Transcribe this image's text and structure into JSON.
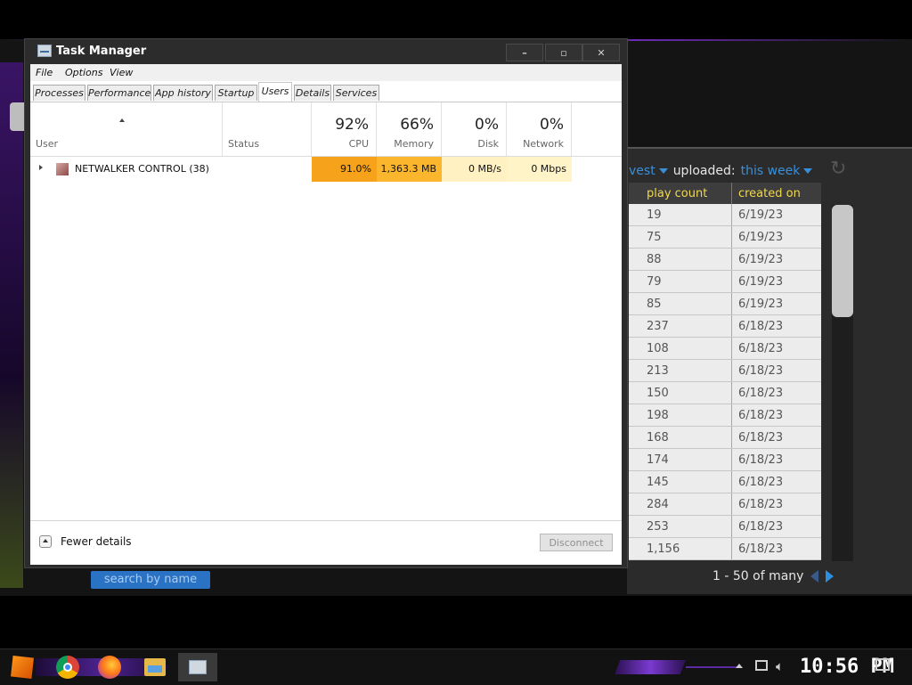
{
  "background_app": {
    "filters": {
      "sort_partial": "vest",
      "uploaded_label": "uploaded:",
      "uploaded_value": "this week"
    },
    "table": {
      "headers": [
        "play count",
        "created on"
      ],
      "rows": [
        [
          "19",
          "6/19/23"
        ],
        [
          "75",
          "6/19/23"
        ],
        [
          "88",
          "6/19/23"
        ],
        [
          "79",
          "6/19/23"
        ],
        [
          "85",
          "6/19/23"
        ],
        [
          "237",
          "6/18/23"
        ],
        [
          "108",
          "6/18/23"
        ],
        [
          "213",
          "6/18/23"
        ],
        [
          "150",
          "6/18/23"
        ],
        [
          "198",
          "6/18/23"
        ],
        [
          "168",
          "6/18/23"
        ],
        [
          "174",
          "6/18/23"
        ],
        [
          "145",
          "6/18/23"
        ],
        [
          "284",
          "6/18/23"
        ],
        [
          "253",
          "6/18/23"
        ],
        [
          "1,156",
          "6/18/23"
        ]
      ]
    },
    "pagination": "1 - 50 of many",
    "search_button": "search by name"
  },
  "task_manager": {
    "title": "Task Manager",
    "window_buttons": {
      "minimize": "–",
      "maximize": "▫",
      "close": "✕"
    },
    "menu": {
      "file": "File",
      "options": "Options",
      "view": "View"
    },
    "tabs": [
      {
        "label": "Processes",
        "active": false
      },
      {
        "label": "Performance",
        "active": false
      },
      {
        "label": "App history",
        "active": false
      },
      {
        "label": "Startup",
        "active": false
      },
      {
        "label": "Users",
        "active": true
      },
      {
        "label": "Details",
        "active": false
      },
      {
        "label": "Services",
        "active": false
      }
    ],
    "columns": {
      "user": "User",
      "status": "Status",
      "cpu": {
        "percent": "92%",
        "label": "CPU"
      },
      "memory": {
        "percent": "66%",
        "label": "Memory"
      },
      "disk": {
        "percent": "0%",
        "label": "Disk"
      },
      "network": {
        "percent": "0%",
        "label": "Network"
      }
    },
    "rows": [
      {
        "user": "NETWALKER CONTROL (38)",
        "status": "",
        "cpu": "91.0%",
        "memory": "1,363.3 MB",
        "disk": "0 MB/s",
        "network": "0 Mbps"
      }
    ],
    "colors": {
      "cpu_heat": "#f6a21b",
      "memory_heat": "#fbb62e",
      "disk_heat": "#fff1c2",
      "network_heat": "#fff3c8"
    },
    "footer": {
      "fewer_details": "Fewer details",
      "disconnect": "Disconnect"
    }
  },
  "taskbar": {
    "clock": "10:56 PM",
    "icons": [
      "start-icon",
      "chrome-icon",
      "firefox-icon",
      "file-explorer-icon",
      "task-manager-icon"
    ]
  }
}
